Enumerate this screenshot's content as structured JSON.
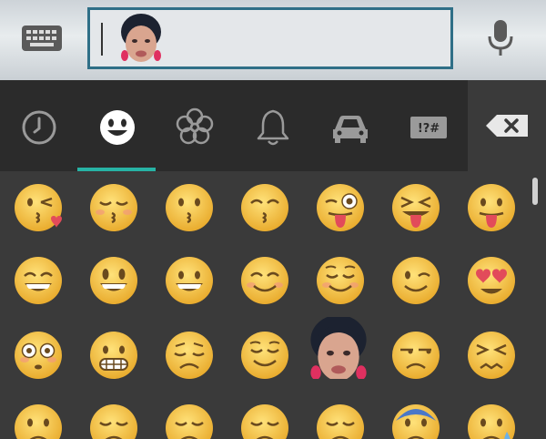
{
  "input": {
    "value": ""
  },
  "categories": [
    {
      "name": "clock-icon"
    },
    {
      "name": "smiley-icon",
      "active": true
    },
    {
      "name": "flower-icon"
    },
    {
      "name": "bell-icon"
    },
    {
      "name": "car-icon"
    },
    {
      "name": "symbols-icon",
      "label": "!?#"
    }
  ],
  "colors": {
    "accent": "#27b3a5",
    "input_border": "#2f6f87",
    "emoji_yellow": "#f7c844"
  },
  "grid_rows": [
    [
      "kissing-heart",
      "kissing-closed-eyes",
      "kissing",
      "kissing-smiling-eyes",
      "stuck-out-tongue-winking-eye",
      "stuck-out-tongue-closed-eyes",
      "stuck-out-tongue"
    ],
    [
      "grin",
      "smiley",
      "grinning",
      "blush",
      "relaxed",
      "wink",
      "heart-eyes"
    ],
    [
      "flushed",
      "grimacing",
      "pensive",
      "relieved",
      "sticker-face",
      "unamused",
      "confounded"
    ],
    [
      "disappointed",
      "sad",
      "sad",
      "sad",
      "sad",
      "cold-sweat",
      "sweat"
    ]
  ]
}
